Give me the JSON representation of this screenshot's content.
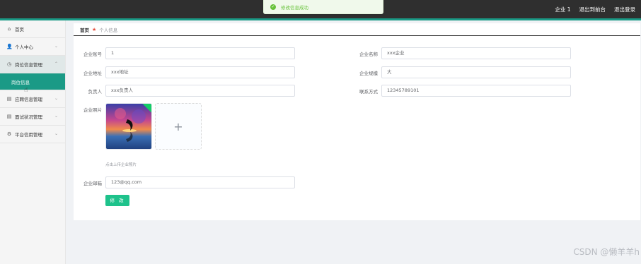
{
  "header": {
    "user": "企业 1",
    "back_to_front": "退出到前台",
    "logout": "退出登录"
  },
  "toast": {
    "icon": "check-icon",
    "message": "修改信息成功"
  },
  "sidebar": {
    "items": [
      {
        "label": "首页",
        "icon": "home-icon"
      },
      {
        "label": "个人中心",
        "icon": "user-icon"
      },
      {
        "label": "岗位信息管理",
        "icon": "clock-icon"
      },
      {
        "label": "岗位信息",
        "icon": ""
      },
      {
        "label": "应聘信息管理",
        "icon": "doc-icon"
      },
      {
        "label": "面试状况管理",
        "icon": "doc-icon"
      },
      {
        "label": "平台信用管理",
        "icon": "gear-icon"
      }
    ]
  },
  "breadcrumb": {
    "home": "首页",
    "current": "个人信息"
  },
  "form": {
    "account_label": "企业账号",
    "account_value": "1",
    "name_label": "企业名称",
    "name_value": "xxx企业",
    "address_label": "企业地址",
    "address_value": "xxx地址",
    "scale_label": "企业规模",
    "scale_value": "大",
    "owner_label": "负责人",
    "owner_value": "xxx负责人",
    "contact_label": "联系方式",
    "contact_value": "12345789101",
    "photo_label": "企业照片",
    "upload_hint": "点击上传企业照片",
    "email_label": "企业邮箱",
    "email_value": "123@qq.com",
    "submit_label": "修 改"
  },
  "watermark": "CSDN @懒羊羊h",
  "colors": {
    "accent": "#1a9a86",
    "submit": "#1ec28b",
    "topbar": "#2f2f2f"
  }
}
